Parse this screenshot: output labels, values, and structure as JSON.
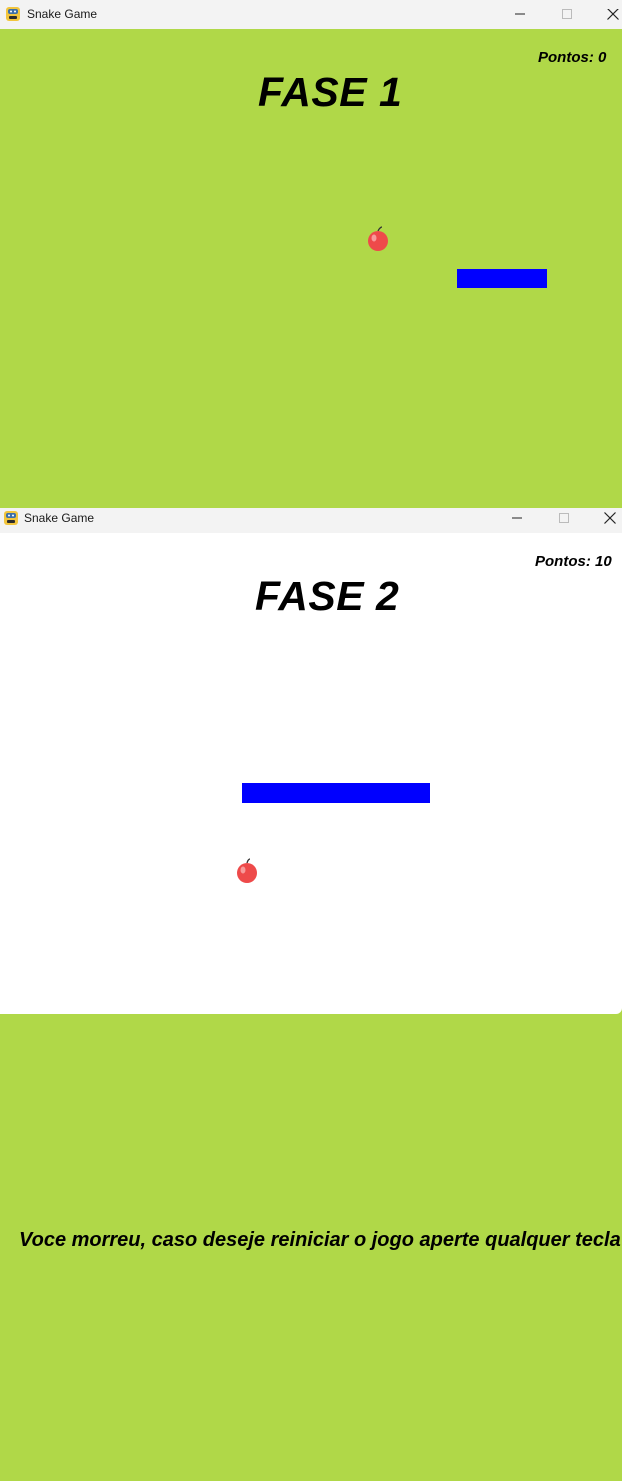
{
  "window1": {
    "title": "Snake Game",
    "score_text": "Pontos: 0",
    "phase_title": "FASE 1",
    "background": "#b0d848",
    "snake_color": "#0000ff"
  },
  "window2": {
    "title": "Snake Game",
    "score_text": "Pontos: 10",
    "phase_title": "FASE 2",
    "background": "#ffffff",
    "snake_color": "#0000ff"
  },
  "gameover": {
    "message": "Voce morreu, caso deseje reiniciar o jogo aperte qualquer tecla",
    "background": "#b0d848"
  },
  "icons": {
    "app": "python-snake-icon",
    "minimize": "minimize-icon",
    "maximize": "maximize-icon",
    "close": "close-icon",
    "food": "apple-icon"
  }
}
